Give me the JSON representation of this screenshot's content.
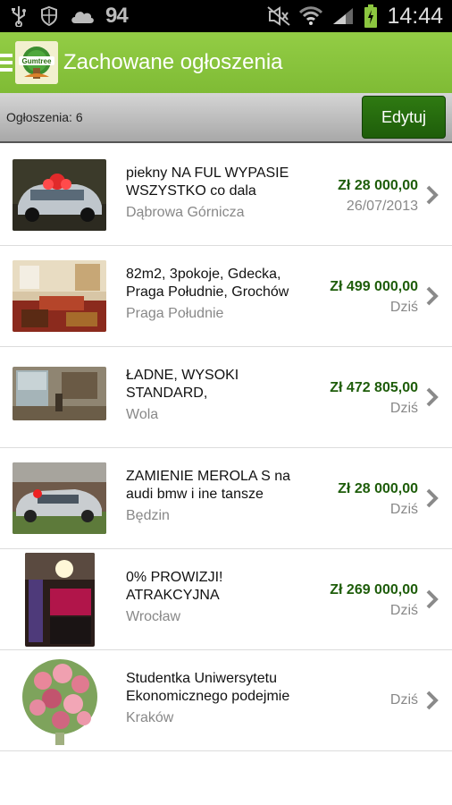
{
  "status_bar": {
    "left_icons": [
      "usb-icon",
      "shield-icon",
      "cloud-icon"
    ],
    "number": "94",
    "right_icons": [
      "mute-icon",
      "wifi-icon",
      "signal-icon",
      "battery-icon"
    ],
    "time": "14:44"
  },
  "app_bar": {
    "logo_text": "Gumtree",
    "title": "Zachowane ogłoszenia"
  },
  "subbar": {
    "count_label": "Ogłoszenia: 6",
    "edit_label": "Edytuj"
  },
  "colors": {
    "accent": "#8cc63f",
    "price": "#1e5d0a",
    "button": "#2a6e11"
  },
  "listings": [
    {
      "title": "piekny NA FUL WYPASIE WSZYSTKO co dala",
      "location": "Dąbrowa Górnicza",
      "price": "Zł 28 000,00",
      "date": "26/07/2013",
      "thumb": "car-with-red-bow"
    },
    {
      "title": "82m2, 3pokoje, Gdecka, Praga Południe, Grochów",
      "location": "Praga Południe",
      "price": "Zł 499 000,00",
      "date": "Dziś",
      "thumb": "living-room"
    },
    {
      "title": "ŁADNE, WYSOKI STANDARD,",
      "location": "Wola",
      "price": "Zł 472 805,00",
      "date": "Dziś",
      "thumb": "apartment-interior"
    },
    {
      "title": "ZAMIENIE MEROLA S na audi bmw i ine tansze",
      "location": "Będzin",
      "price": "Zł 28 000,00",
      "date": "Dziś",
      "thumb": "silver-car"
    },
    {
      "title": "0% PROWIZJI! ATRAKCYJNA",
      "location": "Wrocław",
      "price": "Zł 269 000,00",
      "date": "Dziś",
      "thumb": "kitchen"
    },
    {
      "title": "Studentka Uniwersytetu Ekonomicznego podejmie",
      "location": "Kraków",
      "price": "",
      "date": "Dziś",
      "thumb": "flower-bouquet"
    }
  ]
}
